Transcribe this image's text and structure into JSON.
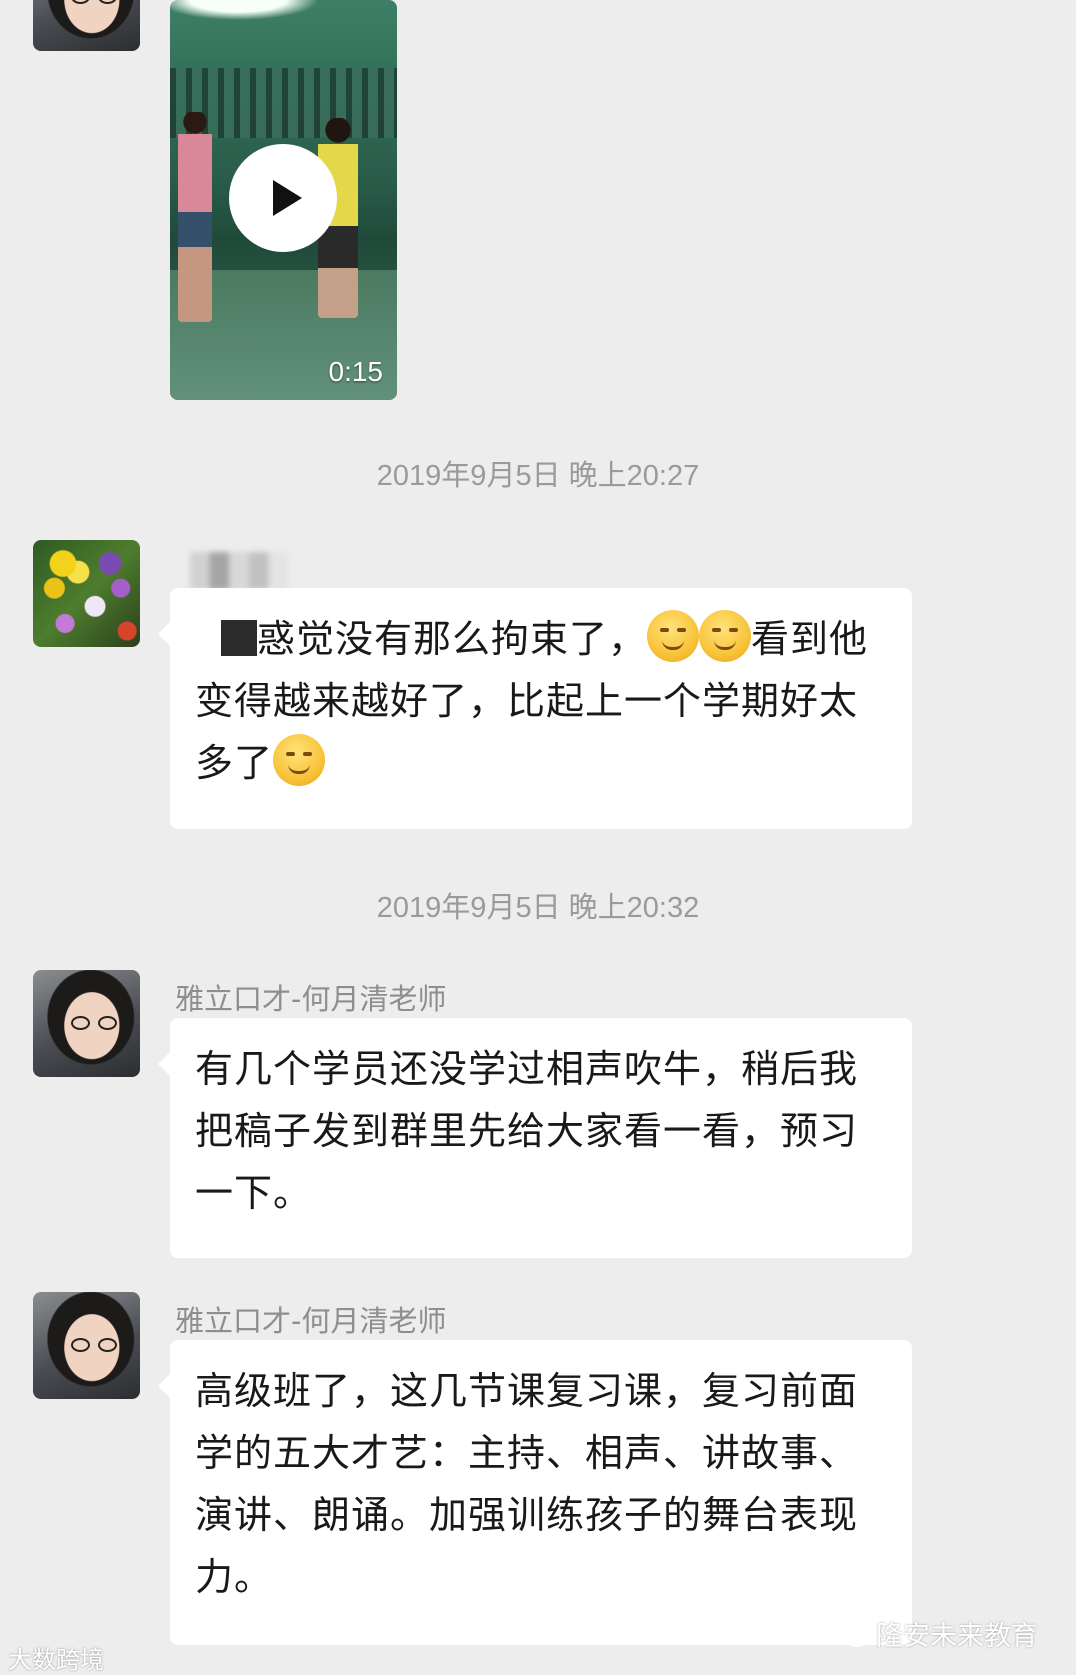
{
  "video": {
    "duration": "0:15"
  },
  "messages": [
    {
      "timestamp": "2019年9月5日 晚上20:27"
    },
    {
      "timestamp": "2019年9月5日 晚上20:32"
    }
  ],
  "chat": {
    "msg1": {
      "part1": "惑觉没有那么拘束了，",
      "part2": "看到他变得越来越好了，比起上一个学期好太多了"
    },
    "msg2": {
      "sender": "雅立口才-何月清老师",
      "text": "有几个学员还没学过相声吹牛，稍后我把稿子发到群里先给大家看一看，预习一下。"
    },
    "msg3": {
      "sender": "雅立口才-何月清老师",
      "text": "高级班了，这几节课复习课，复习前面学的五大才艺：主持、相声、讲故事、演讲、朗诵。加强训练孩子的舞台表现力。"
    }
  },
  "watermarks": {
    "right": "隆安未来教育",
    "left": "大数跨境"
  },
  "colors": {
    "background": "#ededed",
    "bubble": "#ffffff",
    "meta_text": "#9a9a9a"
  }
}
